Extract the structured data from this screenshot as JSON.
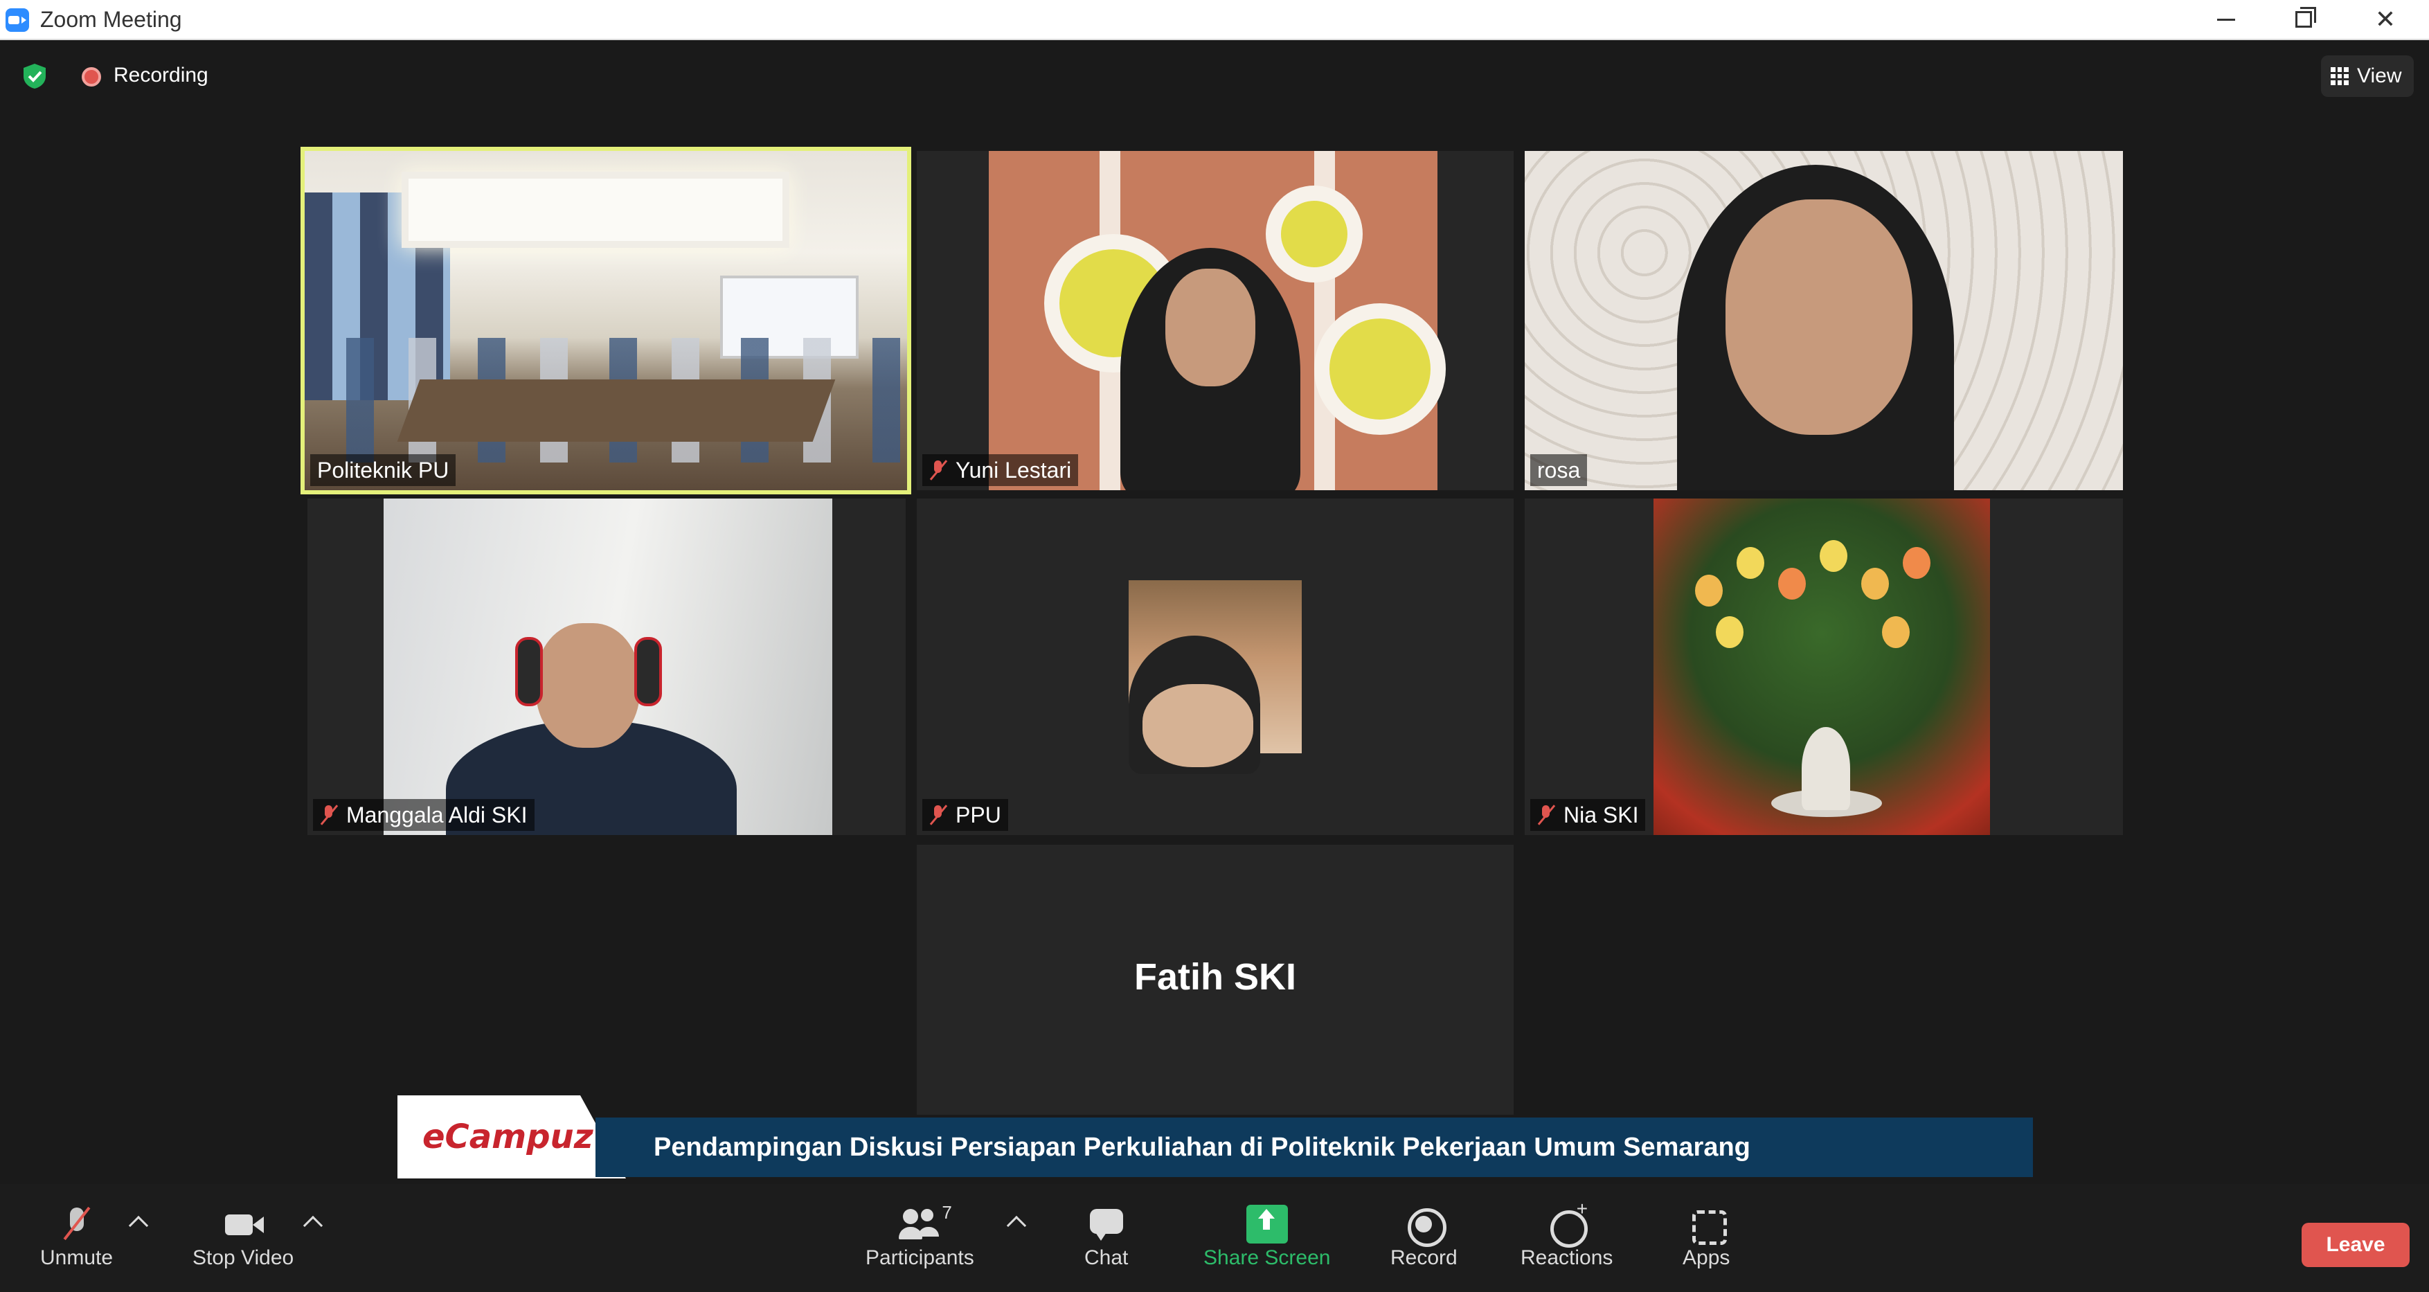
{
  "window": {
    "title": "Zoom Meeting"
  },
  "meeting_bar": {
    "recording_label": "Recording",
    "view_label": "View"
  },
  "participants": [
    {
      "name": "Politeknik PU",
      "muted": false,
      "active_speaker": true
    },
    {
      "name": "Yuni Lestari",
      "muted": true
    },
    {
      "name": "rosa",
      "muted": false
    },
    {
      "name": "Manggala Aldi SKI",
      "muted": true
    },
    {
      "name": "PPU",
      "muted": true
    },
    {
      "name": "Nia SKI",
      "muted": true
    },
    {
      "name": "Fatih SKI",
      "video_off": true
    }
  ],
  "banner": {
    "logo_text": "eCampuz",
    "logo_mark": "®",
    "caption": "Pendampingan Diskusi Persiapan Perkuliahan di Politeknik Pekerjaan Umum Semarang"
  },
  "toolbar": {
    "unmute": "Unmute",
    "stop_video": "Stop Video",
    "participants": "Participants",
    "participants_count": "7",
    "chat": "Chat",
    "share_screen": "Share Screen",
    "record": "Record",
    "reactions": "Reactions",
    "apps": "Apps",
    "leave": "Leave"
  },
  "colors": {
    "active_speaker_border": "#e4f07a",
    "share_green": "#2dbc6a",
    "leave_red": "#e0554f",
    "banner_navy": "#0e3a5c",
    "logo_red": "#c8242d"
  }
}
